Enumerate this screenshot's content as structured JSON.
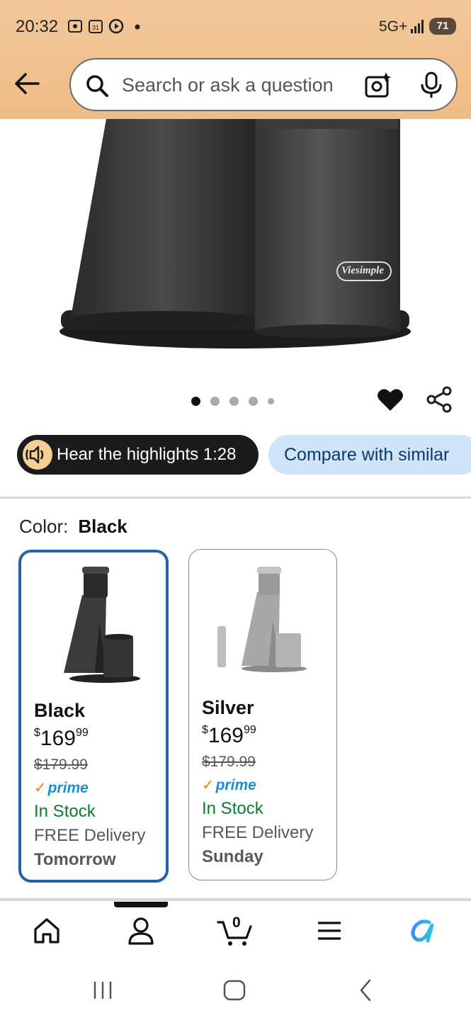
{
  "status_bar": {
    "time": "20:32",
    "network": "5G+",
    "battery": "71"
  },
  "header": {
    "search_placeholder": "Search or ask a question"
  },
  "product": {
    "brand_logo_text": "Viesimple",
    "image_count": 5,
    "active_image_index": 0
  },
  "actions": {
    "hear_highlights": "Hear the highlights 1:28",
    "compare": "Compare with similar"
  },
  "color_section": {
    "label": "Color:",
    "selected": "Black"
  },
  "variants": [
    {
      "name": "Black",
      "currency": "$",
      "price_whole": "169",
      "price_fraction": "99",
      "list_price": "$179.99",
      "prime": "prime",
      "stock": "In Stock",
      "delivery": "FREE Delivery",
      "delivery_day": "Tomorrow"
    },
    {
      "name": "Silver",
      "currency": "$",
      "price_whole": "169",
      "price_fraction": "99",
      "list_price": "$179.99",
      "prime": "prime",
      "stock": "In Stock",
      "delivery": "FREE Delivery",
      "delivery_day": "Sunday"
    }
  ],
  "bottom_nav": {
    "cart_count": "0",
    "items": [
      "home-icon",
      "account-icon",
      "cart-icon",
      "menu-icon",
      "rufus-icon"
    ]
  },
  "colors": {
    "header_bg": "#efbd87",
    "selected_border": "#2462a4",
    "in_stock": "#0b7d2f",
    "prime_blue": "#1a8fd0",
    "compare_bg": "#cfe4f8"
  }
}
